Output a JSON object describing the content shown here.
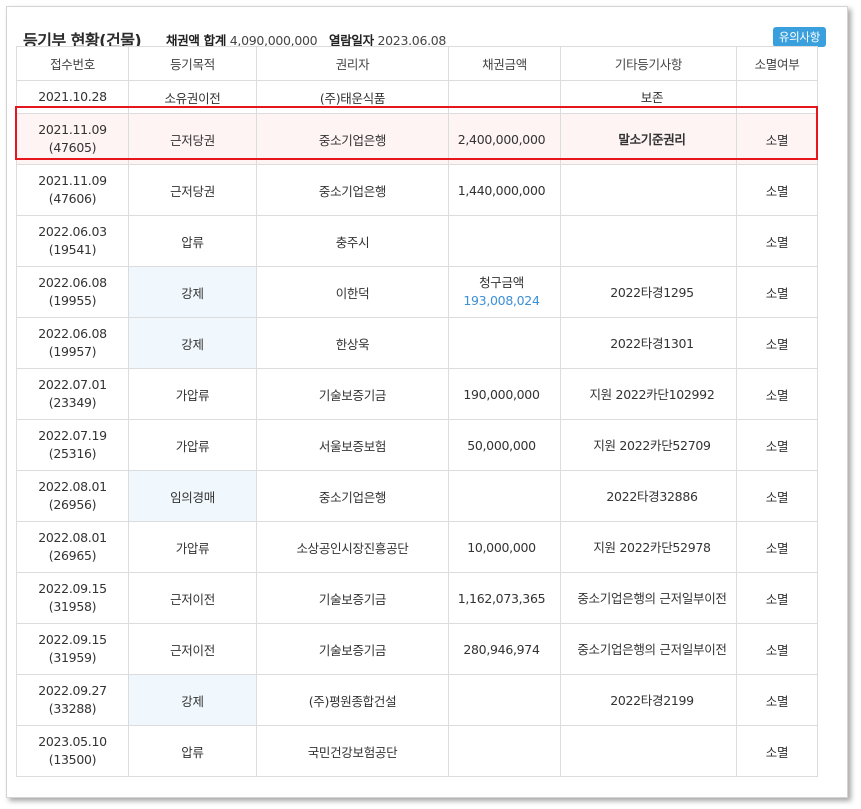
{
  "header": {
    "title": "등기부 현황(건물)",
    "total_label": "채권액 합계",
    "total_value": "4,090,000,000",
    "date_label": "열람일자",
    "date_value": "2023.06.08",
    "notice_button": "유의사항"
  },
  "columns": [
    "접수번호",
    "등기목적",
    "권리자",
    "채권금액",
    "기타등기사항",
    "소멸여부"
  ],
  "rows": [
    {
      "date": "2021.10.28",
      "no": "",
      "purpose": "소유권이전",
      "holder": "(주)태운식품",
      "amount": "",
      "etc": "보존",
      "status": ""
    },
    {
      "date": "2021.11.09",
      "no": "(47605)",
      "purpose": "근저당권",
      "holder": "중소기업은행",
      "amount": "2,400,000,000",
      "etc": "말소기준권리",
      "status": "소멸"
    },
    {
      "date": "2021.11.09",
      "no": "(47606)",
      "purpose": "근저당권",
      "holder": "중소기업은행",
      "amount": "1,440,000,000",
      "etc": "",
      "status": "소멸"
    },
    {
      "date": "2022.06.03",
      "no": "(19541)",
      "purpose": "압류",
      "holder": "충주시",
      "amount": "",
      "etc": "",
      "status": "소멸"
    },
    {
      "date": "2022.06.08",
      "no": "(19955)",
      "purpose": "강제",
      "holder": "이한덕",
      "amount": "",
      "claim_label": "청구금액",
      "claim_value": "193,008,024",
      "etc": "2022타경1295",
      "status": "소멸"
    },
    {
      "date": "2022.06.08",
      "no": "(19957)",
      "purpose": "강제",
      "holder": "한상욱",
      "amount": "",
      "etc": "2022타경1301",
      "status": "소멸"
    },
    {
      "date": "2022.07.01",
      "no": "(23349)",
      "purpose": "가압류",
      "holder": "기술보증기금",
      "amount": "190,000,000",
      "etc": "지원 2022카단102992",
      "status": "소멸"
    },
    {
      "date": "2022.07.19",
      "no": "(25316)",
      "purpose": "가압류",
      "holder": "서울보증보험",
      "amount": "50,000,000",
      "etc": "지원 2022카단52709",
      "status": "소멸"
    },
    {
      "date": "2022.08.01",
      "no": "(26956)",
      "purpose": "임의경매",
      "holder": "중소기업은행",
      "amount": "",
      "etc": "2022타경32886",
      "status": "소멸"
    },
    {
      "date": "2022.08.01",
      "no": "(26965)",
      "purpose": "가압류",
      "holder": "소상공인시장진흥공단",
      "amount": "10,000,000",
      "etc": "지원 2022카단52978",
      "status": "소멸"
    },
    {
      "date": "2022.09.15",
      "no": "(31958)",
      "purpose": "근저이전",
      "holder": "기술보증기금",
      "amount": "1,162,073,365",
      "etc": "중소기업은행의 근저일부이전",
      "status": "소멸"
    },
    {
      "date": "2022.09.15",
      "no": "(31959)",
      "purpose": "근저이전",
      "holder": "기술보증기금",
      "amount": "280,946,974",
      "etc": "중소기업은행의 근저일부이전",
      "status": "소멸"
    },
    {
      "date": "2022.09.27",
      "no": "(33288)",
      "purpose": "강제",
      "holder": "(주)평원종합건설",
      "amount": "",
      "etc": "2022타경2199",
      "status": "소멸"
    },
    {
      "date": "2023.05.10",
      "no": "(13500)",
      "purpose": "압류",
      "holder": "국민건강보험공단",
      "amount": "",
      "etc": "",
      "status": "소멸"
    }
  ],
  "colors": {
    "accent": "#3aa0dd",
    "highlight_border": "#e5161c",
    "claim_value": "#3d8fd6",
    "purpose_tint": "#f1f8fd"
  }
}
